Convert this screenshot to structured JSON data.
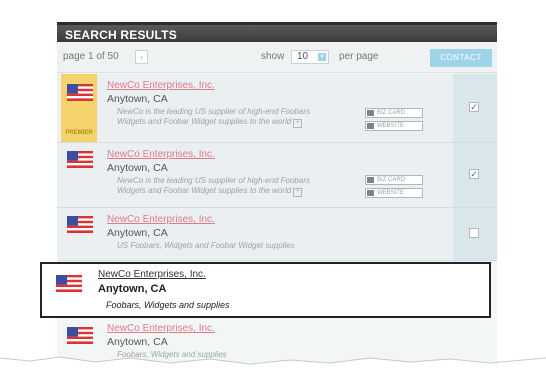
{
  "header": {
    "title": "SEARCH RESULTS"
  },
  "toolbar": {
    "page_text": "page 1 of 50",
    "next_glyph": "›",
    "show_label": "show",
    "per_page_value": "10",
    "per_page_label": "per page",
    "contact_label": "CONTACT"
  },
  "tags": {
    "biz_card": "BIZ CARD",
    "website": "WEBSITE"
  },
  "results": [
    {
      "name": "NewCo Enterprises, Inc.",
      "city": "Anytown, CA",
      "desc_line1": "NewCo is the leading US supplier of high-end Foobars",
      "desc_line2": "Widgets and Foobar Widget supplies to the world",
      "premier_label": "PREMIER",
      "checked": "✓"
    },
    {
      "name": "NewCo Enterprises, Inc.",
      "city": "Anytown, CA",
      "desc_line1": "NewCo is the leading US supplier of high-end Foobars",
      "desc_line2": "Widgets and Foobar Widget supplies to the world",
      "checked": "✓"
    },
    {
      "name": "NewCo Enterprises, Inc.",
      "city": "Anytown, CA",
      "desc_line1": "US Foobars, Widgets and Foobar Widget supplies",
      "checked": ""
    },
    {
      "name": "NewCo Enterprises, Inc.",
      "city": "Anytown, CA",
      "desc_line1": "Foobars, Widgets and supplies"
    },
    {
      "name": "NewCo Enterprises, Inc.",
      "city": "Anytown, CA",
      "desc_line1": "Foobars, Widgets and supplies"
    }
  ],
  "colors": {
    "accent": "#9fd3e9",
    "premier": "#f3d36a",
    "link": "#e07a85"
  },
  "icons": {
    "flag": "us-flag-icon",
    "checkbox": "checkbox-icon",
    "more": "more-icon"
  }
}
